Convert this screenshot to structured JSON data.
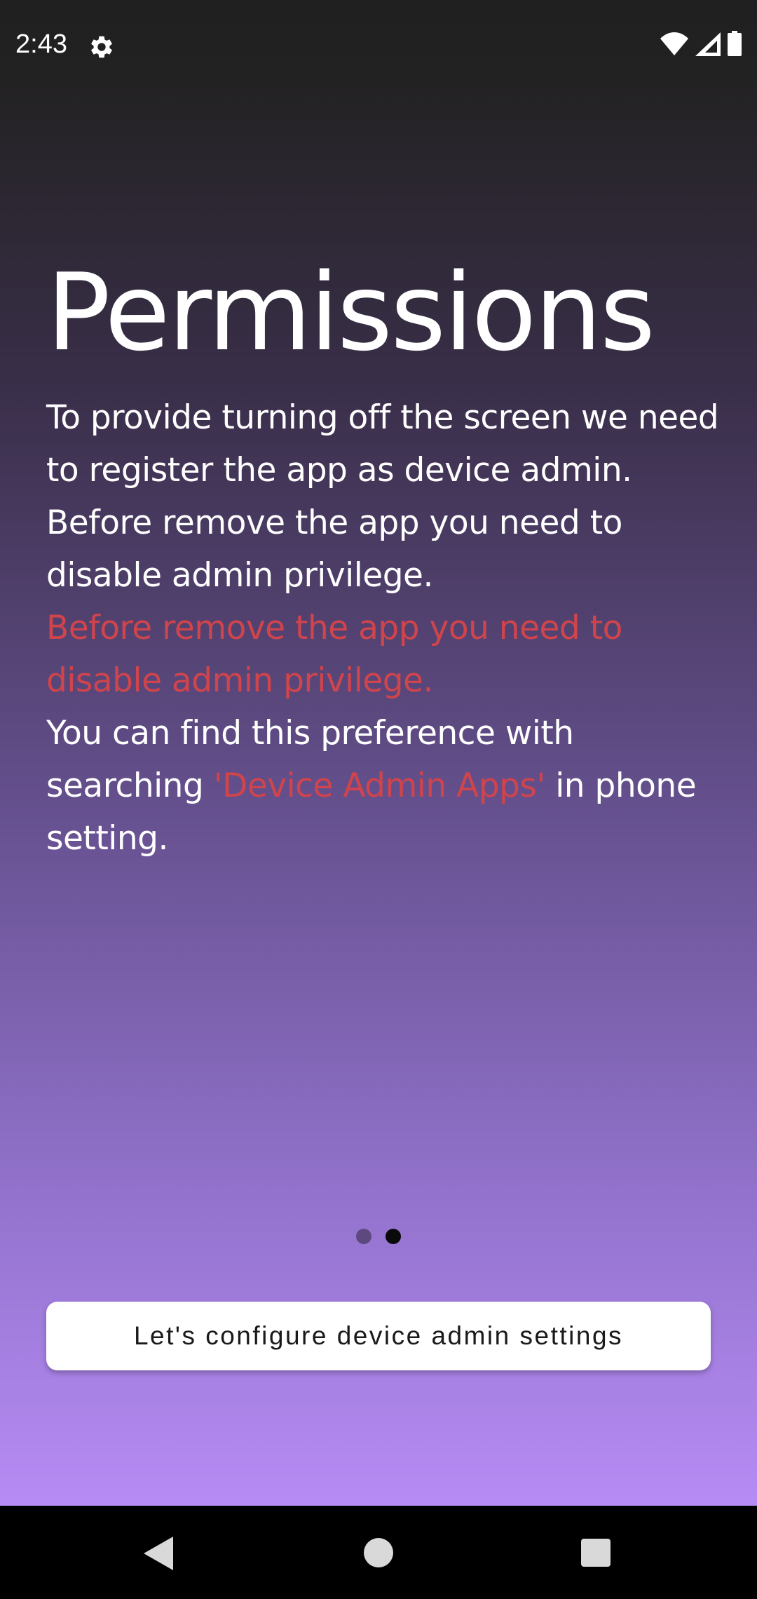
{
  "status_bar": {
    "time": "2:43",
    "icons": [
      "settings-gear-icon",
      "wifi-icon",
      "cellular-signal-icon",
      "battery-icon"
    ]
  },
  "content": {
    "title": "Permissions",
    "paragraph_1": "To provide turning off the screen we need to register the app as device admin. Before remove the app you need to disable admin privilege.",
    "warning": "Before remove the app you need to disable admin privilege.",
    "find_prefix": "You can find this preference with searching ",
    "find_highlight": "'Device Admin Apps'",
    "find_suffix": " in phone setting."
  },
  "page_indicator": {
    "total_pages": 2,
    "current_page": 2
  },
  "button": {
    "label": "Let's configure device admin settings"
  },
  "colors": {
    "warning_text": "#d0444c",
    "gradient_top": "#202020",
    "gradient_bottom": "#b78cf5"
  },
  "nav_bar": {
    "icons": [
      "back-icon",
      "home-icon",
      "recents-icon"
    ]
  }
}
